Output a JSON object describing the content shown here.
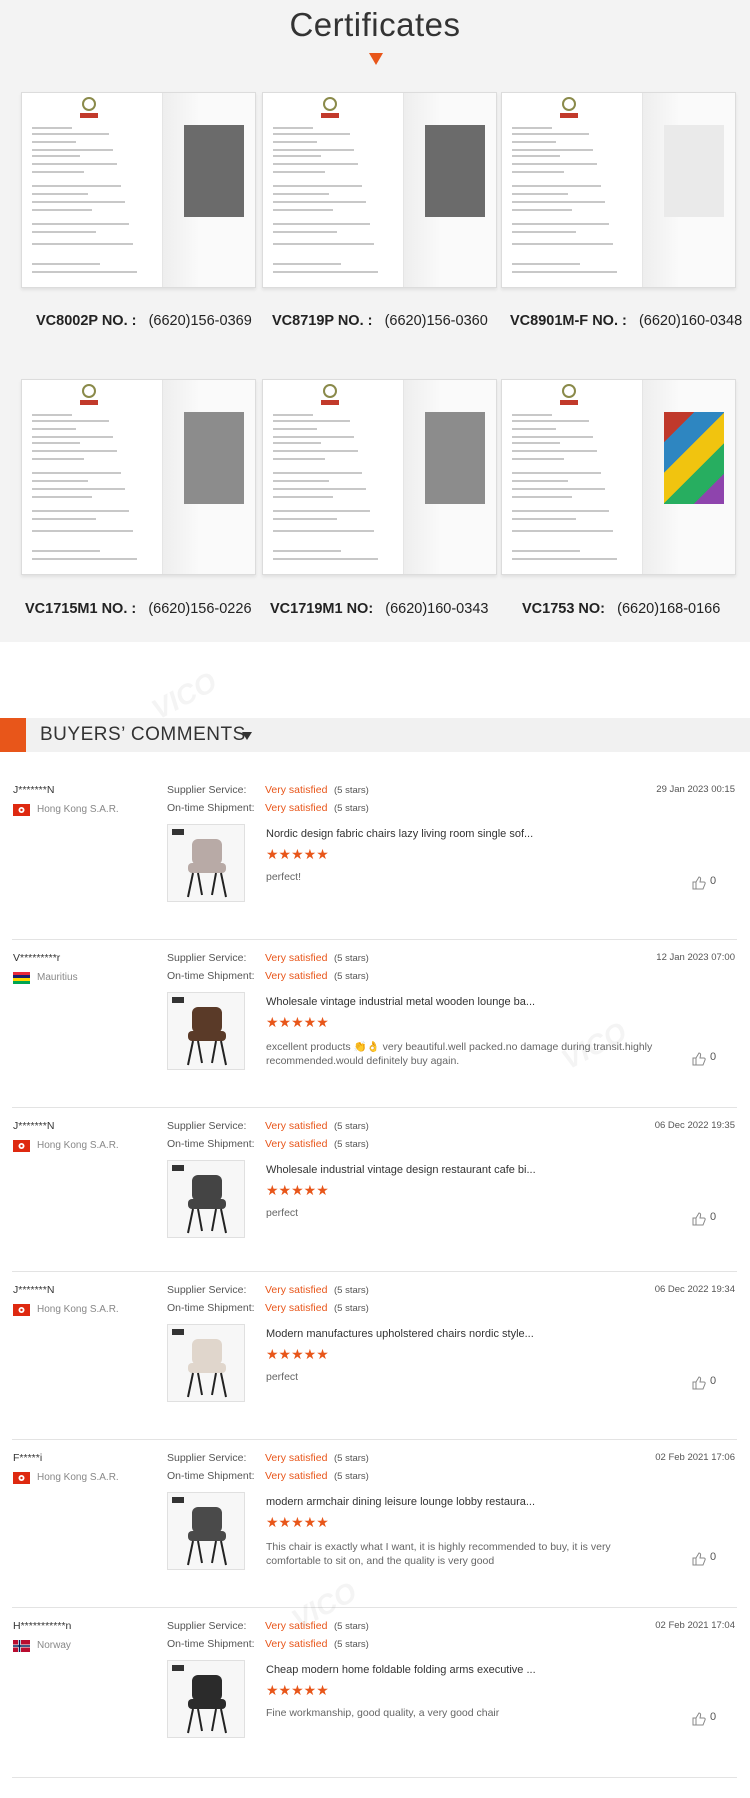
{
  "certificates": {
    "title": "Certificates",
    "items": [
      {
        "model": "VC8002P NO. :",
        "number": "(6620)156-0369",
        "photo": "dark"
      },
      {
        "model": "VC8719P NO. :",
        "number": "(6620)156-0360",
        "photo": "dark"
      },
      {
        "model": "VC8901M-F NO. :",
        "number": "(6620)160-0348",
        "photo": "light"
      },
      {
        "model": "VC1715M1 NO. :",
        "number": "(6620)156-0226",
        "photo": "gray"
      },
      {
        "model": "VC1719M1 NO:",
        "number": "(6620)160-0343",
        "photo": "gray"
      },
      {
        "model": "VC1753 NO:",
        "number": "(6620)168-0166",
        "photo": "colorful"
      }
    ]
  },
  "comments": {
    "title": "BUYERS’   COMMENTS",
    "supplier_label": "Supplier Service:",
    "shipment_label": "On-time Shipment:",
    "satisfied": "Very satisfied",
    "stars_text": "(5 stars)",
    "star_glyphs": "★★★★★",
    "reviews": [
      {
        "reviewer": "J*******N",
        "country": "Hong Kong S.A.R.",
        "flag": "hk",
        "date": "29 Jan 2023 00:15",
        "product": "Nordic design fabric chairs lazy living room single sof...",
        "comment": "perfect!",
        "likes": "0",
        "img": "fabric"
      },
      {
        "reviewer": "V*********r",
        "country": "Mauritius",
        "flag": "mu",
        "date": "12 Jan 2023 07:00",
        "product": "Wholesale vintage industrial metal wooden lounge ba...",
        "comment": "excellent products 👏👌 very beautiful.well packed.no damage during transit.highly recommended.would definitely buy again.",
        "likes": "0",
        "img": "stool"
      },
      {
        "reviewer": "J*******N",
        "country": "Hong Kong S.A.R.",
        "flag": "hk",
        "date": "06 Dec 2022 19:35",
        "product": "Wholesale industrial vintage design restaurant cafe bi...",
        "comment": "perfect",
        "likes": "0",
        "img": "metal"
      },
      {
        "reviewer": "J*******N",
        "country": "Hong Kong S.A.R.",
        "flag": "hk",
        "date": "06 Dec 2022 19:34",
        "product": "Modern manufactures upholstered chairs nordic style...",
        "comment": "perfect",
        "likes": "0",
        "img": "tufted"
      },
      {
        "reviewer": "F*****i",
        "country": "Hong Kong S.A.R.",
        "flag": "hk",
        "date": "02 Feb 2021 17:06",
        "product": "modern armchair dining leisure lounge lobby restaura...",
        "comment": "This chair is exactly what I want, it is highly recommended to buy, it is very comfortable to sit on, and the quality is very good",
        "likes": "0",
        "img": "armchair"
      },
      {
        "reviewer": "H***********n",
        "country": "Norway",
        "flag": "no",
        "date": "02 Feb 2021 17:04",
        "product": "Cheap modern home foldable folding arms executive ...",
        "comment": "Fine workmanship, good quality, a very good chair",
        "likes": "0",
        "img": "office"
      }
    ]
  }
}
